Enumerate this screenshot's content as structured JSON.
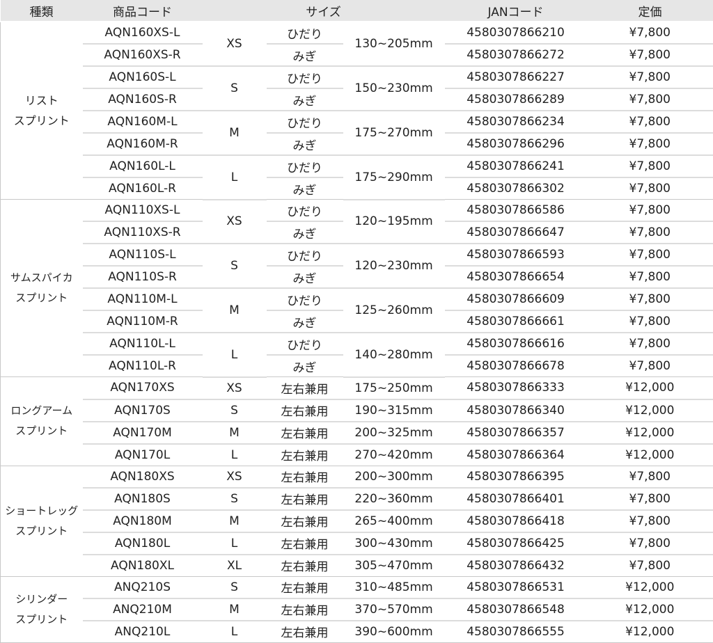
{
  "headers": {
    "kind": "種類",
    "code": "商品コード",
    "size": "サイズ",
    "jan": "JANコード",
    "price": "定価"
  },
  "groups": [
    {
      "kind": [
        "リスト",
        "スプリント"
      ],
      "sizes": [
        {
          "size": "XS",
          "range": "130~205mm",
          "rows": [
            {
              "code": "AQN160XS-L",
              "side": "ひだり",
              "jan": "4580307866210",
              "price": "¥7,800"
            },
            {
              "code": "AQN160XS-R",
              "side": "みぎ",
              "jan": "4580307866272",
              "price": "¥7,800"
            }
          ]
        },
        {
          "size": "S",
          "range": "150~230mm",
          "rows": [
            {
              "code": "AQN160S-L",
              "side": "ひだり",
              "jan": "4580307866227",
              "price": "¥7,800"
            },
            {
              "code": "AQN160S-R",
              "side": "みぎ",
              "jan": "4580307866289",
              "price": "¥7,800"
            }
          ]
        },
        {
          "size": "M",
          "range": "175~270mm",
          "rows": [
            {
              "code": "AQN160M-L",
              "side": "ひだり",
              "jan": "4580307866234",
              "price": "¥7,800"
            },
            {
              "code": "AQN160M-R",
              "side": "みぎ",
              "jan": "4580307866296",
              "price": "¥7,800"
            }
          ]
        },
        {
          "size": "L",
          "range": "175~290mm",
          "rows": [
            {
              "code": "AQN160L-L",
              "side": "ひだり",
              "jan": "4580307866241",
              "price": "¥7,800"
            },
            {
              "code": "AQN160L-R",
              "side": "みぎ",
              "jan": "4580307866302",
              "price": "¥7,800"
            }
          ]
        }
      ]
    },
    {
      "kind": [
        "サムスパイカ",
        "スプリント"
      ],
      "small": true,
      "sizes": [
        {
          "size": "XS",
          "range": "120~195mm",
          "rows": [
            {
              "code": "AQN110XS-L",
              "side": "ひだり",
              "jan": "4580307866586",
              "price": "¥7,800"
            },
            {
              "code": "AQN110XS-R",
              "side": "みぎ",
              "jan": "4580307866647",
              "price": "¥7,800"
            }
          ]
        },
        {
          "size": "S",
          "range": "120~230mm",
          "rows": [
            {
              "code": "AQN110S-L",
              "side": "ひだり",
              "jan": "4580307866593",
              "price": "¥7,800"
            },
            {
              "code": "AQN110S-R",
              "side": "みぎ",
              "jan": "4580307866654",
              "price": "¥7,800"
            }
          ]
        },
        {
          "size": "M",
          "range": "125~260mm",
          "rows": [
            {
              "code": "AQN110M-L",
              "side": "ひだり",
              "jan": "4580307866609",
              "price": "¥7,800"
            },
            {
              "code": "AQN110M-R",
              "side": "みぎ",
              "jan": "4580307866661",
              "price": "¥7,800"
            }
          ]
        },
        {
          "size": "L",
          "range": "140~280mm",
          "rows": [
            {
              "code": "AQN110L-L",
              "side": "ひだり",
              "jan": "4580307866616",
              "price": "¥7,800"
            },
            {
              "code": "AQN110L-R",
              "side": "みぎ",
              "jan": "4580307866678",
              "price": "¥7,800"
            }
          ]
        }
      ]
    },
    {
      "kind": [
        "ロングアーム",
        "スプリント"
      ],
      "small": true,
      "sizes": [
        {
          "size": "XS",
          "range": "175~250mm",
          "rows": [
            {
              "code": "AQN170XS",
              "side": "左右兼用",
              "jan": "4580307866333",
              "price": "¥12,000"
            }
          ]
        },
        {
          "size": "S",
          "range": "190~315mm",
          "rows": [
            {
              "code": "AQN170S",
              "side": "左右兼用",
              "jan": "4580307866340",
              "price": "¥12,000"
            }
          ]
        },
        {
          "size": "M",
          "range": "200~325mm",
          "rows": [
            {
              "code": "AQN170M",
              "side": "左右兼用",
              "jan": "4580307866357",
              "price": "¥12,000"
            }
          ]
        },
        {
          "size": "L",
          "range": "270~420mm",
          "rows": [
            {
              "code": "AQN170L",
              "side": "左右兼用",
              "jan": "4580307866364",
              "price": "¥12,000"
            }
          ]
        }
      ]
    },
    {
      "kind": [
        "ショートレッグ",
        "スプリント"
      ],
      "small": true,
      "sizes": [
        {
          "size": "XS",
          "range": "200~300mm",
          "rows": [
            {
              "code": "AQN180XS",
              "side": "左右兼用",
              "jan": "4580307866395",
              "price": "¥7,800"
            }
          ]
        },
        {
          "size": "S",
          "range": "220~360mm",
          "rows": [
            {
              "code": "AQN180S",
              "side": "左右兼用",
              "jan": "4580307866401",
              "price": "¥7,800"
            }
          ]
        },
        {
          "size": "M",
          "range": "265~400mm",
          "rows": [
            {
              "code": "AQN180M",
              "side": "左右兼用",
              "jan": "4580307866418",
              "price": "¥7,800"
            }
          ]
        },
        {
          "size": "L",
          "range": "300~430mm",
          "rows": [
            {
              "code": "AQN180L",
              "side": "左右兼用",
              "jan": "4580307866425",
              "price": "¥7,800"
            }
          ]
        },
        {
          "size": "XL",
          "range": "305~470mm",
          "rows": [
            {
              "code": "AQN180XL",
              "side": "左右兼用",
              "jan": "4580307866432",
              "price": "¥7,800"
            }
          ]
        }
      ]
    },
    {
      "kind": [
        "シリンダー",
        "スプリント"
      ],
      "small": true,
      "sizes": [
        {
          "size": "S",
          "range": "310~485mm",
          "rows": [
            {
              "code": "ANQ210S",
              "side": "左右兼用",
              "jan": "4580307866531",
              "price": "¥12,000"
            }
          ]
        },
        {
          "size": "M",
          "range": "370~570mm",
          "rows": [
            {
              "code": "ANQ210M",
              "side": "左右兼用",
              "jan": "4580307866548",
              "price": "¥12,000"
            }
          ]
        },
        {
          "size": "L",
          "range": "390~600mm",
          "rows": [
            {
              "code": "ANQ210L",
              "side": "左右兼用",
              "jan": "4580307866555",
              "price": "¥12,000"
            }
          ]
        }
      ]
    }
  ]
}
